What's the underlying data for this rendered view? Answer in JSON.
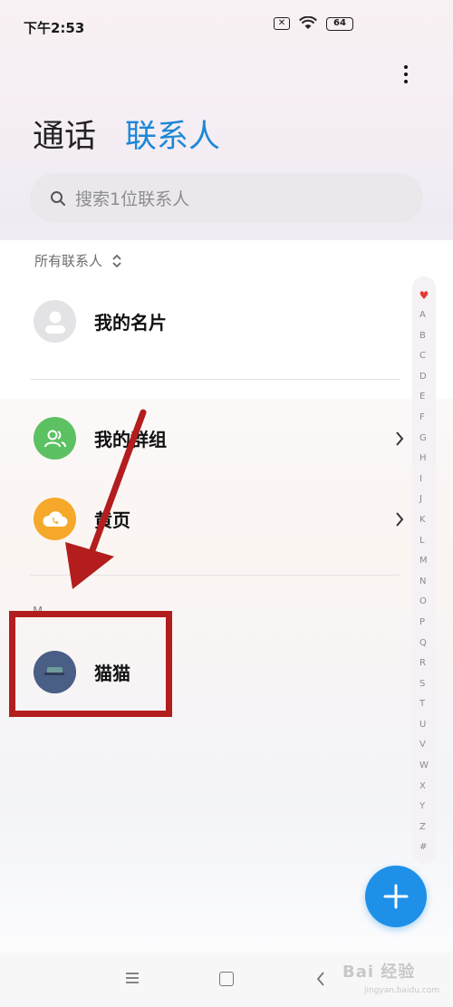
{
  "status_bar": {
    "time": "下午2:53",
    "battery": "64"
  },
  "header": {
    "tab_calls": "通话",
    "tab_contacts": "联系人"
  },
  "search": {
    "placeholder": "搜索1位联系人"
  },
  "section": {
    "label": "所有联系人"
  },
  "rows": {
    "my_card": "我的名片",
    "my_groups": "我的群组",
    "yellow_pages": "黄页",
    "contact_name": "猫猫"
  },
  "group_letter": "M",
  "index_bar": {
    "top_symbol": "♥",
    "letters": [
      "A",
      "B",
      "C",
      "D",
      "E",
      "F",
      "G",
      "H",
      "I",
      "J",
      "K",
      "L",
      "M",
      "N",
      "O",
      "P",
      "Q",
      "R",
      "S",
      "T",
      "U",
      "V",
      "W",
      "X",
      "Y",
      "Z",
      "#"
    ]
  },
  "watermark": {
    "main": "Bai 经验",
    "sub": "jingyan.baidu.com"
  },
  "colors": {
    "accent": "#1e88d6",
    "fab": "#1e90e8",
    "annotation": "#b31d1d",
    "groups_icon": "#5bc162",
    "yellow_pages_icon": "#f6a82a"
  },
  "icons": {
    "more": "more-vertical-icon",
    "search": "search-icon",
    "sort": "sort-updown-icon",
    "my_card": "person-icon",
    "my_groups": "group-icon",
    "yellow_pages": "cloud-phone-icon",
    "chevron": "chevron-right-icon",
    "add": "plus-icon"
  }
}
